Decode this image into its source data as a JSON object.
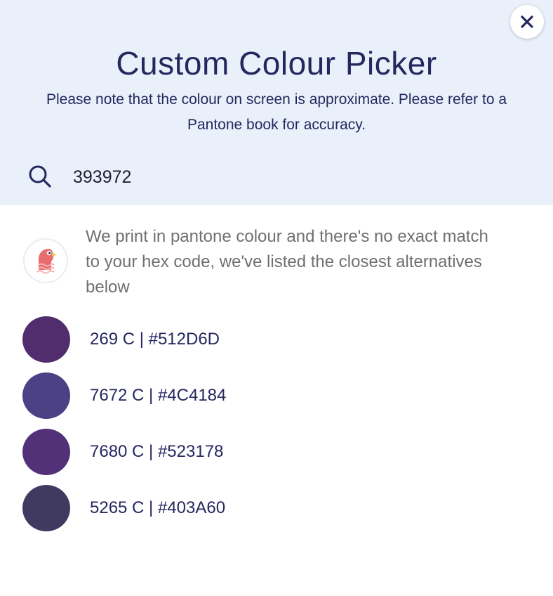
{
  "dialog": {
    "title": "Custom Colour Picker",
    "note": "Please note that the colour on screen is approximate. Please refer to a Pantone book for accuracy.",
    "close_icon": "close-icon"
  },
  "search": {
    "icon": "search-icon",
    "value": "393972"
  },
  "info": {
    "avatar_icon": "parrot-mascot-icon",
    "message": "We print in pantone colour and there's no exact match to your hex code, we've listed the closest alternatives below"
  },
  "swatches": [
    {
      "label": "269 C | #512D6D",
      "color": "#512D6D"
    },
    {
      "label": "7672 C | #4C4184",
      "color": "#4C4184"
    },
    {
      "label": "7680 C | #523178",
      "color": "#523178"
    },
    {
      "label": "5265 C | #403A60",
      "color": "#403A60"
    }
  ]
}
